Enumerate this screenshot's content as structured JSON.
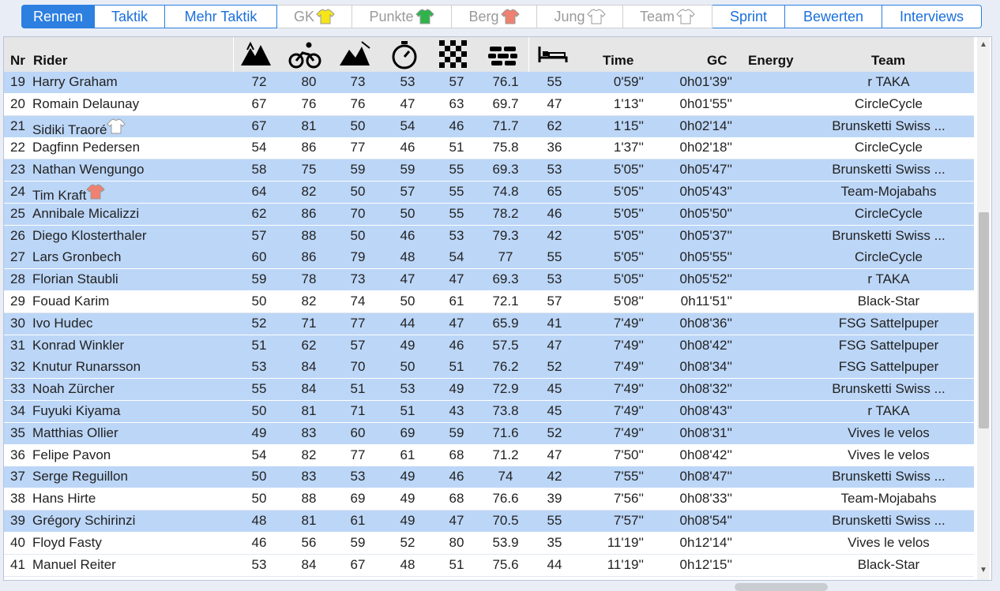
{
  "tabs": [
    {
      "label": "Rennen",
      "state": "active",
      "w": 93
    },
    {
      "label": "Taktik",
      "state": "normal",
      "w": 89
    },
    {
      "label": "Mehr Taktik",
      "state": "normal",
      "w": 142
    },
    {
      "label": "GK",
      "state": "disabled",
      "w": 95,
      "jersey": "#f5e51a"
    },
    {
      "label": "Punkte",
      "state": "disabled",
      "w": 126,
      "jersey": "#2fb34b"
    },
    {
      "label": "Berg",
      "state": "disabled",
      "w": 108,
      "jersey": "#f08070"
    },
    {
      "label": "Jung",
      "state": "disabled",
      "w": 109,
      "jersey": "#ffffff"
    },
    {
      "label": "Team",
      "state": "disabled",
      "w": 113,
      "jersey": "#ffffff"
    },
    {
      "label": "Sprint",
      "state": "normal",
      "w": 92
    },
    {
      "label": "Bewerten",
      "state": "normal",
      "w": 123
    },
    {
      "label": "Interviews",
      "state": "normal",
      "w": 126
    }
  ],
  "columns": {
    "nr": "Nr",
    "rider": "Rider",
    "time": "Time",
    "gc": "GC",
    "energy": "Energy",
    "team": "Team",
    "icons": [
      "mountain-icon",
      "cycling-icon",
      "hills-icon",
      "stopwatch-icon",
      "checkered-flag-icon",
      "cobblestone-icon",
      "bed-icon"
    ]
  },
  "colors": {
    "row_blue": "#bcd6f7",
    "tab_active": "#2d7fe0",
    "header_bg": "#e6e6e6"
  },
  "rows": [
    {
      "nr": "19",
      "rider": "Harry Graham",
      "s": [
        "72",
        "80",
        "73",
        "53",
        "57",
        "76.1",
        "55"
      ],
      "time": "0'59''",
      "gc": "0h01'39''",
      "team": "r TAKA",
      "bg": "blue"
    },
    {
      "nr": "20",
      "rider": "Romain Delaunay",
      "s": [
        "67",
        "76",
        "76",
        "47",
        "63",
        "69.7",
        "47"
      ],
      "time": "1'13''",
      "gc": "0h01'55''",
      "team": "CircleCycle",
      "bg": "white"
    },
    {
      "nr": "21",
      "rider": "Sidiki Traoré",
      "s": [
        "67",
        "81",
        "50",
        "54",
        "46",
        "71.7",
        "62"
      ],
      "time": "1'15''",
      "gc": "0h02'14''",
      "team": "Brunsketti Swiss ...",
      "bg": "blue",
      "jersey": "#ffffff"
    },
    {
      "nr": "22",
      "rider": "Dagfinn Pedersen",
      "s": [
        "54",
        "86",
        "77",
        "46",
        "51",
        "75.8",
        "36"
      ],
      "time": "1'37''",
      "gc": "0h02'18''",
      "team": "CircleCycle",
      "bg": "white"
    },
    {
      "nr": "23",
      "rider": "Nathan Wengungo",
      "s": [
        "58",
        "75",
        "59",
        "59",
        "55",
        "69.3",
        "53"
      ],
      "time": "5'05''",
      "gc": "0h05'47''",
      "team": "Brunsketti Swiss ...",
      "bg": "blue"
    },
    {
      "nr": "24",
      "rider": "Tim Kraft",
      "s": [
        "64",
        "82",
        "50",
        "57",
        "55",
        "74.8",
        "65"
      ],
      "time": "5'05''",
      "gc": "0h05'43''",
      "team": "Team-Mojabahs",
      "bg": "blue",
      "jersey": "#f08070"
    },
    {
      "nr": "25",
      "rider": "Annibale Micalizzi",
      "s": [
        "62",
        "86",
        "70",
        "50",
        "55",
        "78.2",
        "46"
      ],
      "time": "5'05''",
      "gc": "0h05'50''",
      "team": "CircleCycle",
      "bg": "blue"
    },
    {
      "nr": "26",
      "rider": "Diego Klosterthaler",
      "s": [
        "57",
        "88",
        "50",
        "46",
        "53",
        "79.3",
        "42"
      ],
      "time": "5'05''",
      "gc": "0h05'37''",
      "team": "Brunsketti Swiss ...",
      "bg": "blue"
    },
    {
      "nr": "27",
      "rider": "Lars Gronbech",
      "s": [
        "60",
        "86",
        "79",
        "48",
        "54",
        "77",
        "55"
      ],
      "time": "5'05''",
      "gc": "0h05'55''",
      "team": "CircleCycle",
      "bg": "blue"
    },
    {
      "nr": "28",
      "rider": "Florian Staubli",
      "s": [
        "59",
        "78",
        "73",
        "47",
        "47",
        "69.3",
        "53"
      ],
      "time": "5'05''",
      "gc": "0h05'52''",
      "team": "r TAKA",
      "bg": "blue"
    },
    {
      "nr": "29",
      "rider": "Fouad Karim",
      "s": [
        "50",
        "82",
        "74",
        "50",
        "61",
        "72.1",
        "57"
      ],
      "time": "5'08''",
      "gc": "0h11'51''",
      "team": "Black-Star",
      "bg": "white"
    },
    {
      "nr": "30",
      "rider": "Ivo Hudec",
      "s": [
        "52",
        "71",
        "77",
        "44",
        "47",
        "65.9",
        "41"
      ],
      "time": "7'49''",
      "gc": "0h08'36''",
      "team": "FSG Sattelpuper",
      "bg": "blue"
    },
    {
      "nr": "31",
      "rider": "Konrad Winkler",
      "s": [
        "51",
        "62",
        "57",
        "49",
        "46",
        "57.5",
        "47"
      ],
      "time": "7'49''",
      "gc": "0h08'42''",
      "team": "FSG Sattelpuper",
      "bg": "blue"
    },
    {
      "nr": "32",
      "rider": "Knutur Runarsson",
      "s": [
        "53",
        "84",
        "70",
        "50",
        "51",
        "76.2",
        "52"
      ],
      "time": "7'49''",
      "gc": "0h08'34''",
      "team": "FSG Sattelpuper",
      "bg": "blue"
    },
    {
      "nr": "33",
      "rider": "Noah Zürcher",
      "s": [
        "55",
        "84",
        "51",
        "53",
        "49",
        "72.9",
        "45"
      ],
      "time": "7'49''",
      "gc": "0h08'32''",
      "team": "Brunsketti Swiss ...",
      "bg": "blue"
    },
    {
      "nr": "34",
      "rider": "Fuyuki Kiyama",
      "s": [
        "50",
        "81",
        "71",
        "51",
        "43",
        "73.8",
        "45"
      ],
      "time": "7'49''",
      "gc": "0h08'43''",
      "team": "r TAKA",
      "bg": "blue"
    },
    {
      "nr": "35",
      "rider": "Matthias Ollier",
      "s": [
        "49",
        "83",
        "60",
        "69",
        "59",
        "71.6",
        "52"
      ],
      "time": "7'49''",
      "gc": "0h08'31''",
      "team": "Vives le velos",
      "bg": "blue"
    },
    {
      "nr": "36",
      "rider": "Felipe Pavon",
      "s": [
        "54",
        "82",
        "77",
        "61",
        "68",
        "71.2",
        "47"
      ],
      "time": "7'50''",
      "gc": "0h08'42''",
      "team": "Vives le velos",
      "bg": "white"
    },
    {
      "nr": "37",
      "rider": "Serge Reguillon",
      "s": [
        "50",
        "83",
        "53",
        "49",
        "46",
        "74",
        "42"
      ],
      "time": "7'55''",
      "gc": "0h08'47''",
      "team": "Brunsketti Swiss ...",
      "bg": "blue"
    },
    {
      "nr": "38",
      "rider": "Hans Hirte",
      "s": [
        "50",
        "88",
        "69",
        "49",
        "68",
        "76.6",
        "39"
      ],
      "time": "7'56''",
      "gc": "0h08'33''",
      "team": "Team-Mojabahs",
      "bg": "white"
    },
    {
      "nr": "39",
      "rider": "Grégory Schirinzi",
      "s": [
        "48",
        "81",
        "61",
        "49",
        "47",
        "70.5",
        "55"
      ],
      "time": "7'57''",
      "gc": "0h08'54''",
      "team": "Brunsketti Swiss ...",
      "bg": "blue"
    },
    {
      "nr": "40",
      "rider": "Floyd Fasty",
      "s": [
        "46",
        "56",
        "59",
        "52",
        "80",
        "53.9",
        "35"
      ],
      "time": "11'19''",
      "gc": "0h12'14''",
      "team": "Vives le velos",
      "bg": "white"
    },
    {
      "nr": "41",
      "rider": "Manuel Reiter",
      "s": [
        "53",
        "84",
        "67",
        "48",
        "51",
        "75.6",
        "44"
      ],
      "time": "11'19''",
      "gc": "0h12'15''",
      "team": "Black-Star",
      "bg": "white"
    }
  ]
}
